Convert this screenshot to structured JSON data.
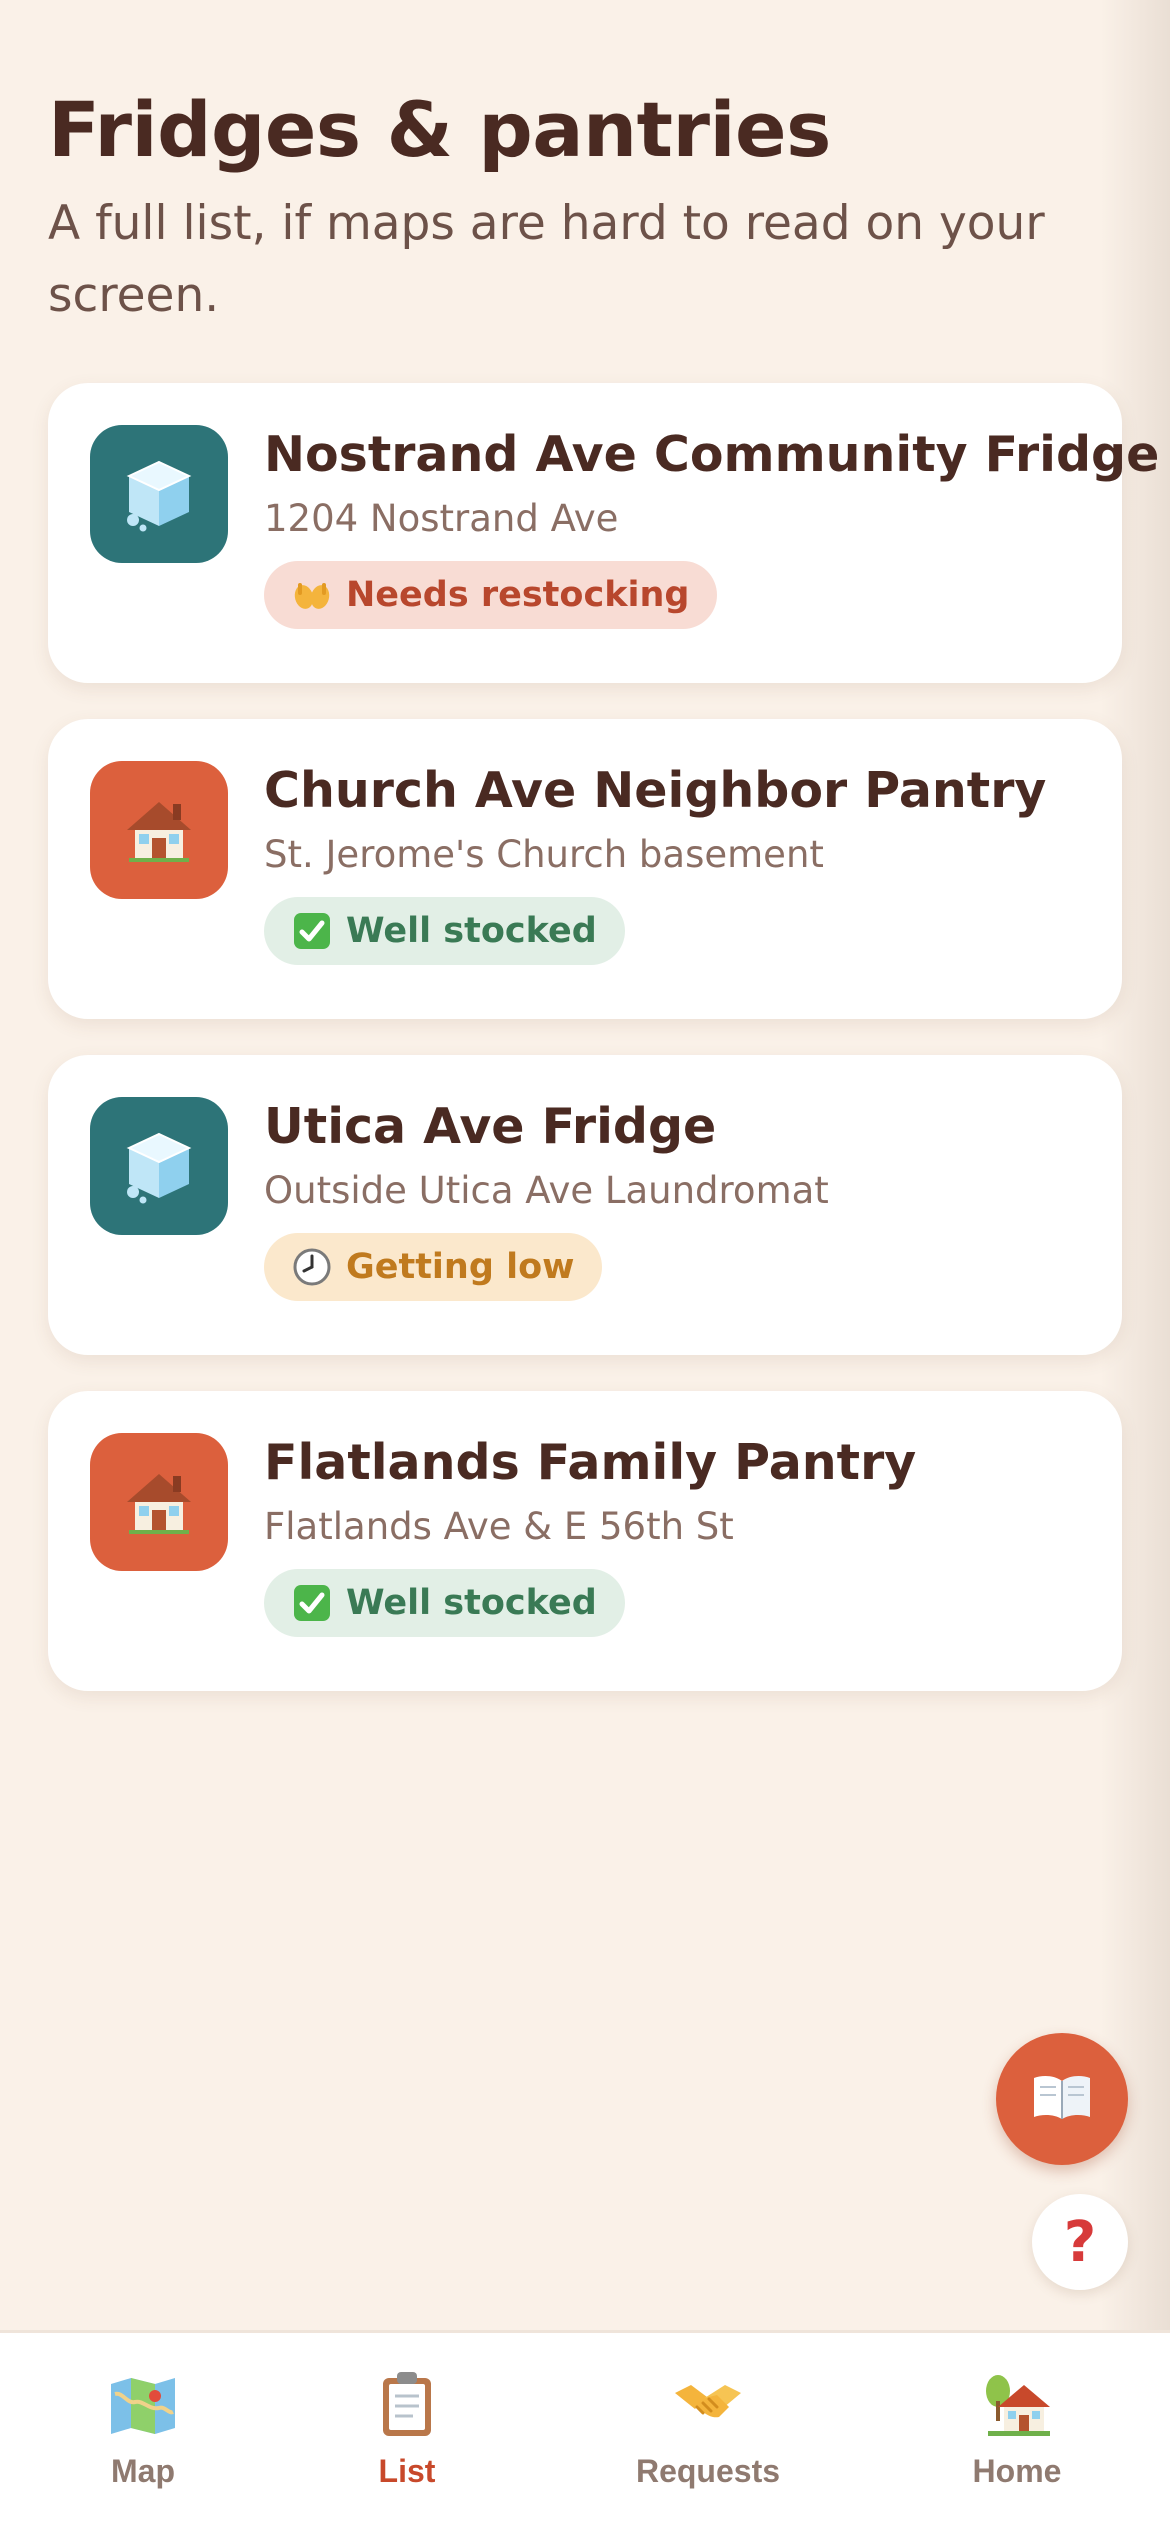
{
  "header": {
    "title": "Fridges & pantries",
    "subtitle": "A full list, if maps are hard to read on your screen."
  },
  "colors": {
    "fridge_icon_bg": "#2d7478",
    "pantry_icon_bg": "#dc603d",
    "accent": "#c8492b"
  },
  "locations": [
    {
      "name": "Nostrand Ave Community Fridge",
      "address": "1204 Nostrand Ave",
      "icon": "ice-cube-icon",
      "status": "Needs restocking",
      "status_icon": "open-hands-icon",
      "status_bg": "#f8dcd4",
      "status_color": "#b8472d"
    },
    {
      "name": "Church Ave Neighbor Pantry",
      "address": "St. Jerome's Church basement",
      "icon": "house-icon",
      "status": "Well stocked",
      "status_icon": "check-mark-icon",
      "status_bg": "#e2efe6",
      "status_color": "#3a7a55"
    },
    {
      "name": "Utica Ave Fridge",
      "address": "Outside Utica Ave Laundromat",
      "icon": "ice-cube-icon",
      "status": "Getting low",
      "status_icon": "clock-icon",
      "status_bg": "#fbe8cc",
      "status_color": "#c07a1e"
    },
    {
      "name": "Flatlands Family Pantry",
      "address": "Flatlands Ave & E 56th St",
      "icon": "house-icon",
      "status": "Well stocked",
      "status_icon": "check-mark-icon",
      "status_bg": "#e2efe6",
      "status_color": "#3a7a55"
    }
  ],
  "fab": {
    "guide_icon": "open-book-icon",
    "help_label": "?"
  },
  "tabs": [
    {
      "label": "Map",
      "icon": "map-icon",
      "active": false
    },
    {
      "label": "List",
      "icon": "clipboard-icon",
      "active": true
    },
    {
      "label": "Requests",
      "icon": "handshake-icon",
      "active": false
    },
    {
      "label": "Home",
      "icon": "house-icon",
      "active": false
    }
  ]
}
